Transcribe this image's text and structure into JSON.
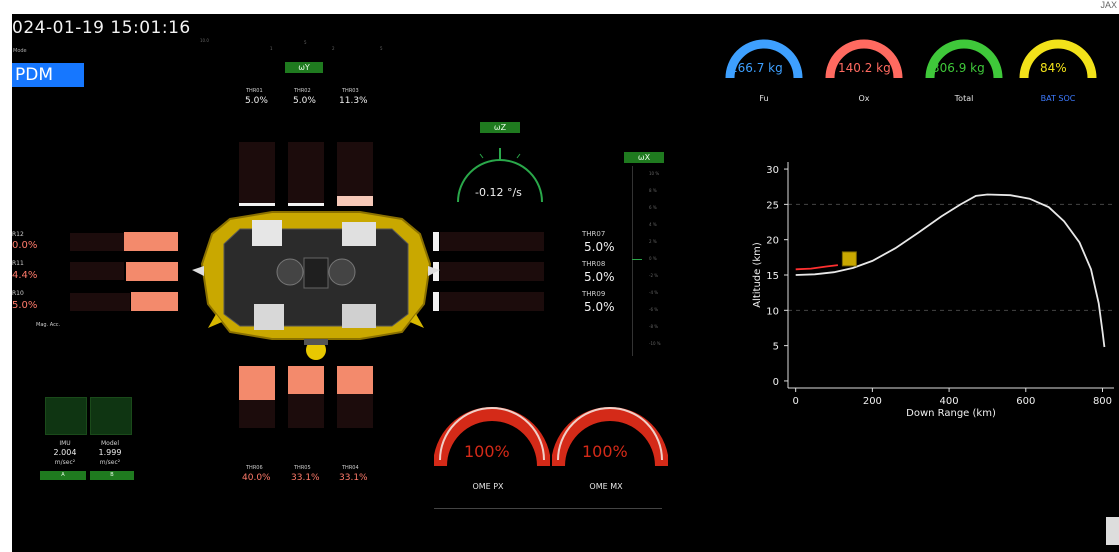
{
  "watermark": "JAX",
  "timestamp": "024-01-19 15:01:16",
  "mode_label": "Mode",
  "mode_value": "PDM",
  "top_ticks": [
    "10.0",
    "1",
    "5",
    "2",
    "5"
  ],
  "omega_y": {
    "label": "ωY"
  },
  "omega_z": {
    "label": "ωZ",
    "value": "-0.12 °/s"
  },
  "omega_x": {
    "label": "ωX",
    "ticks": [
      "10 %",
      "8 %",
      "6 %",
      "4 %",
      "2 %",
      "0 %",
      "-2 %",
      "-4 %",
      "-6 %",
      "-8 %",
      "-10 %"
    ]
  },
  "thrusters_top": [
    {
      "name": "THR01",
      "value": "5.0%"
    },
    {
      "name": "THR02",
      "value": "5.0%"
    },
    {
      "name": "THR03",
      "value": "11.3%"
    }
  ],
  "thrusters_bottom": [
    {
      "name": "THR06",
      "value": "40.0%"
    },
    {
      "name": "THR05",
      "value": "33.1%"
    },
    {
      "name": "THR04",
      "value": "33.1%"
    }
  ],
  "thrusters_right": [
    {
      "name": "THR07",
      "value": "5.0%"
    },
    {
      "name": "THR08",
      "value": "5.0%"
    },
    {
      "name": "THR09",
      "value": "5.0%"
    }
  ],
  "thrusters_left": [
    {
      "name": "R12",
      "value": "0.0%"
    },
    {
      "name": "R11",
      "value": "4.4%"
    },
    {
      "name": "R10",
      "value": "5.0%"
    }
  ],
  "mag_acc_label": "Mag. Acc.",
  "imu": {
    "label": "IMU",
    "value": "2.004",
    "unit": "m/sec²",
    "button": "A"
  },
  "model": {
    "label": "Model",
    "value": "1.999",
    "unit": "m/sec²",
    "button": "B"
  },
  "engines": [
    {
      "name": "OME PX",
      "value": "100%"
    },
    {
      "name": "OME MX",
      "value": "100%"
    }
  ],
  "gauges": [
    {
      "name": "Fu",
      "value": "166.7 kg",
      "color": "#3ea0ff",
      "fraction": 0.7
    },
    {
      "name": "Ox",
      "value": "140.2 kg",
      "color": "#ff6a60",
      "fraction": 0.7
    },
    {
      "name": "Total",
      "value": "306.9 kg",
      "color": "#3fc83a",
      "fraction": 0.7
    },
    {
      "name": "BAT SOC",
      "value": "84%",
      "color": "#f2e21a",
      "fraction": 0.84
    }
  ],
  "bat_soc_label_color": "#3e7bff",
  "chart_data": {
    "type": "line",
    "xlabel": "Down Range (km)",
    "ylabel": "Altitude (km)",
    "xlim": [
      -20,
      830
    ],
    "ylim": [
      -1,
      31
    ],
    "xticks": [
      0,
      200,
      400,
      600,
      800
    ],
    "yticks": [
      0,
      5,
      10,
      15,
      20,
      25,
      30
    ],
    "dashed_gridlines_y": [
      10,
      25
    ],
    "series": [
      {
        "name": "",
        "color": "#e8e8e8",
        "x": [
          0,
          50,
          100,
          150,
          200,
          260,
          320,
          380,
          430,
          470,
          500,
          560,
          610,
          660,
          700,
          740,
          770,
          790,
          800,
          805
        ],
        "y": [
          15,
          15.1,
          15.4,
          16.0,
          17.0,
          18.8,
          21.0,
          23.3,
          25.0,
          26.2,
          26.4,
          26.3,
          25.8,
          24.6,
          22.6,
          19.6,
          15.8,
          11.0,
          7.0,
          4.8
        ]
      },
      {
        "name": "",
        "color": "#ff3030",
        "x": [
          0,
          40,
          80,
          110
        ],
        "y": [
          15.8,
          15.9,
          16.2,
          16.4
        ]
      }
    ]
  }
}
